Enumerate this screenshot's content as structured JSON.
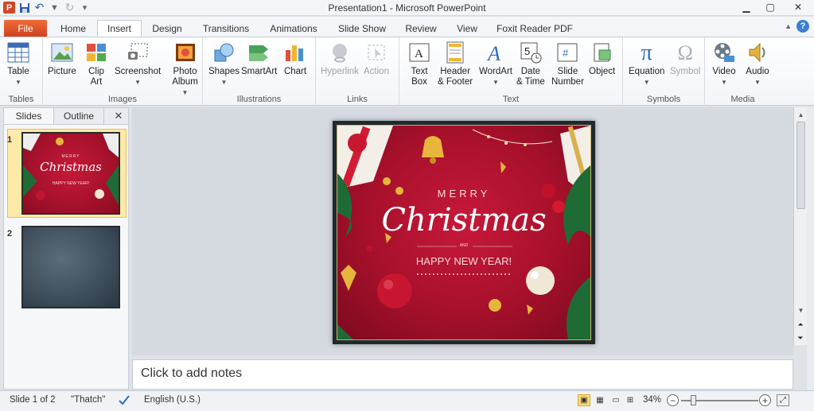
{
  "window": {
    "title": "Presentation1  -  Microsoft PowerPoint"
  },
  "tabs": [
    {
      "label": "File"
    },
    {
      "label": "Home"
    },
    {
      "label": "Insert"
    },
    {
      "label": "Design"
    },
    {
      "label": "Transitions"
    },
    {
      "label": "Animations"
    },
    {
      "label": "Slide Show"
    },
    {
      "label": "Review"
    },
    {
      "label": "View"
    },
    {
      "label": "Foxit Reader PDF"
    }
  ],
  "ribbon": {
    "tables": {
      "label": "Tables",
      "table": "Table"
    },
    "images": {
      "label": "Images",
      "picture": "Picture",
      "clipart": [
        "Clip",
        "Art"
      ],
      "screenshot": "Screenshot",
      "photoalbum": [
        "Photo",
        "Album"
      ]
    },
    "illustrations": {
      "label": "Illustrations",
      "shapes": "Shapes",
      "smartart": "SmartArt",
      "chart": "Chart"
    },
    "links": {
      "label": "Links",
      "hyperlink": "Hyperlink",
      "action": "Action"
    },
    "text": {
      "label": "Text",
      "textbox": [
        "Text",
        "Box"
      ],
      "headerfooter": [
        "Header",
        "& Footer"
      ],
      "wordart": "WordArt",
      "datetime": [
        "Date",
        "& Time"
      ],
      "slidenumber": [
        "Slide",
        "Number"
      ],
      "object": "Object"
    },
    "symbols": {
      "label": "Symbols",
      "equation": "Equation",
      "symbol": "Symbol"
    },
    "media": {
      "label": "Media",
      "video": "Video",
      "audio": "Audio"
    }
  },
  "pane": {
    "tabs": [
      "Slides",
      "Outline"
    ],
    "slides": [
      {
        "number": "1",
        "merry": "MERRY",
        "christmas": "Christmas",
        "newyear": "HAPPY NEW YEAR!"
      },
      {
        "number": "2"
      }
    ]
  },
  "slide": {
    "merry": "MERRY",
    "christmas": "Christmas",
    "and": "AND",
    "newyear": "HAPPY NEW YEAR!"
  },
  "notes": {
    "placeholder": "Click to add notes"
  },
  "status": {
    "slide": "Slide 1 of 2",
    "theme": "\"Thatch\"",
    "language": "English (U.S.)",
    "zoom": "34%"
  },
  "colors": {
    "file_tab": "#d0421a",
    "slide_bg": "#a6102b",
    "gold": "#e5b53c",
    "selected_thumb": "#fde9a8"
  }
}
